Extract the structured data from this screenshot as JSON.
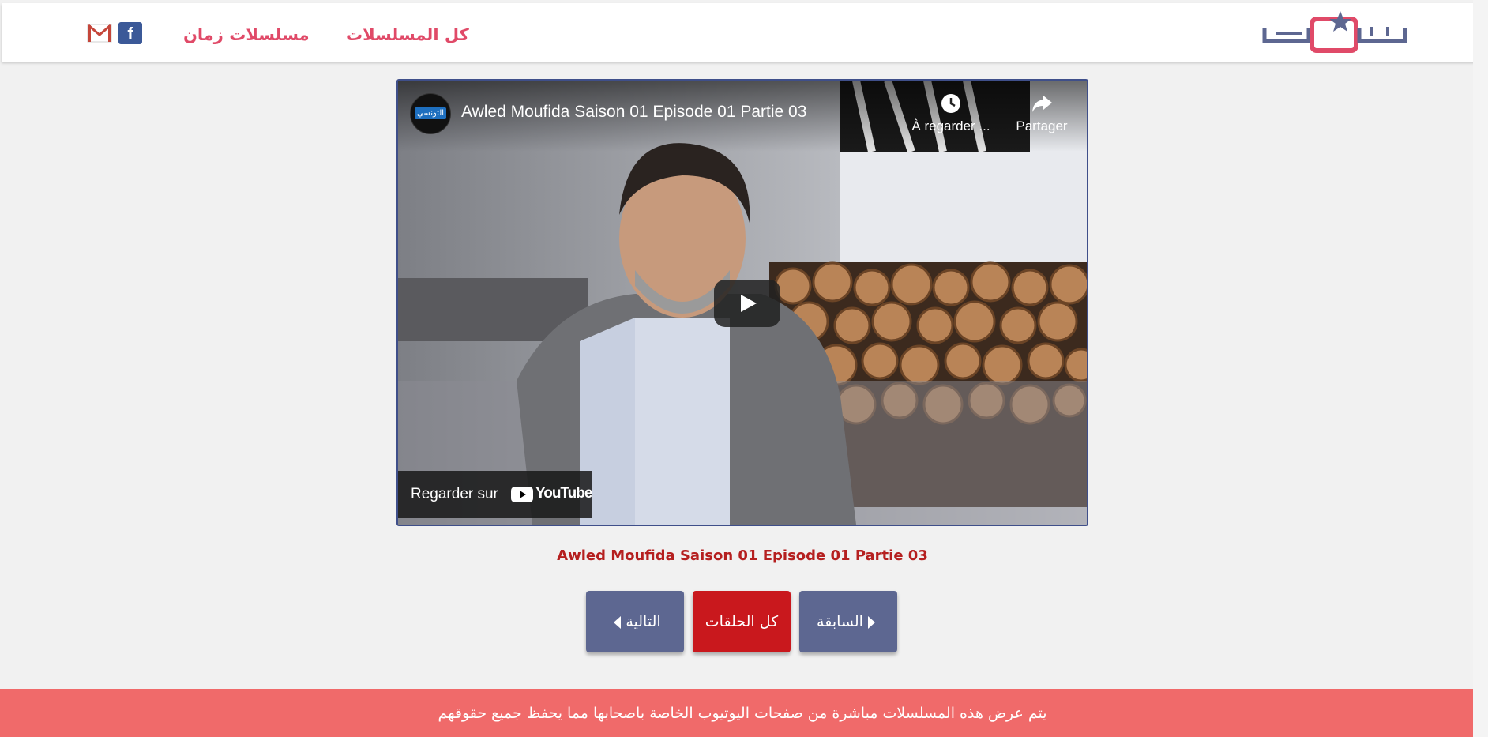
{
  "header": {
    "logo_text": "تيونسي",
    "nav": {
      "all_series": "كل المسلسلات",
      "old_series": "مسلسلات زمان"
    },
    "social": {
      "facebook_glyph": "f"
    }
  },
  "video": {
    "title": "Awled Moufida Saison 01 Episode 01 Partie 03",
    "channel_avatar_text": "التونسي",
    "watch_later_label": "À regarder ...",
    "share_label": "Partager",
    "watch_on_label": "Regarder sur",
    "youtube_word": "YouTube"
  },
  "episode_title": "Awled Moufida Saison 01 Episode 01 Partie 03",
  "buttons": {
    "next": "التالية",
    "all_episodes": "كل الحلقات",
    "previous": "السابقة"
  },
  "footer": {
    "notice": "يتم عرض هذه المسلسلات مباشرة من صفحات اليوتيوب الخاصة باصحابها مما يحفظ جميع حقوقهم"
  },
  "colors": {
    "brand_pink": "#e04a68",
    "brand_navy": "#5d6791",
    "accent_red": "#c9181d",
    "footer_bg": "#f06a6a"
  }
}
